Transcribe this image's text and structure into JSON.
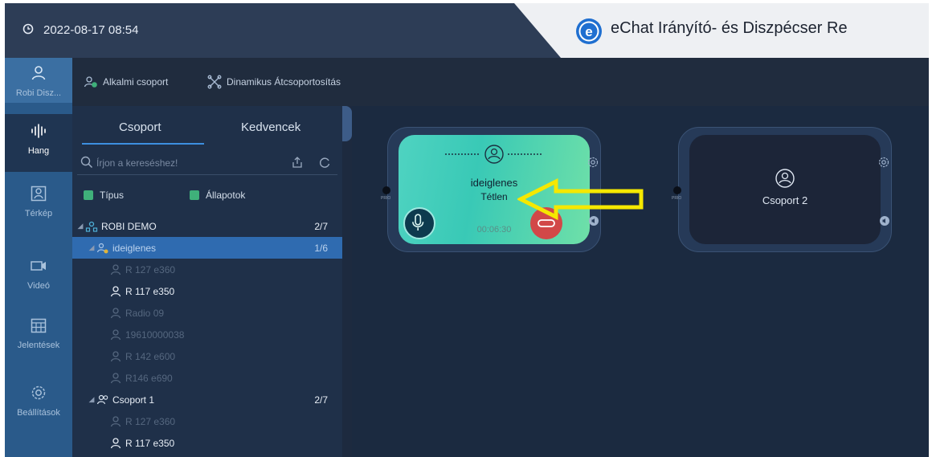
{
  "titlebar": {
    "datetime": "2022-08-17 08:54",
    "app_title": "eChat Irányító-  és Diszpécser Re",
    "logo_letter": "e"
  },
  "nav": [
    {
      "id": "robi",
      "label": "Robi Disz...",
      "icon": "person-icon"
    },
    {
      "id": "hang",
      "label": "Hang",
      "icon": "audio-wave-icon"
    },
    {
      "id": "terkep",
      "label": "Térkép",
      "icon": "map-person-icon"
    },
    {
      "id": "video",
      "label": "Videó",
      "icon": "video-camera-icon"
    },
    {
      "id": "jelentesek",
      "label": "Jelentések",
      "icon": "calendar-grid-icon"
    },
    {
      "id": "beallitasok",
      "label": "Beállítások",
      "icon": "gear-icon"
    }
  ],
  "toolbar": {
    "ad_hoc_group": "Alkalmi csoport",
    "dynamic_regroup": "Dinamikus Átcsoportosítás"
  },
  "panel": {
    "tab_groups": "Csoport",
    "tab_favorites": "Kedvencek",
    "search_placeholder": "Írjon a kereséshez!",
    "filter_type": "Típus",
    "filter_status": "Állapotok"
  },
  "tree": [
    {
      "label": "ROBI DEMO",
      "count": "2/7",
      "kind": "org"
    },
    {
      "label": "ideiglenes",
      "count": "1/6",
      "kind": "group-selected"
    },
    {
      "label": "R 127 e360",
      "kind": "member-offline"
    },
    {
      "label": "R 117 e350",
      "kind": "member-online"
    },
    {
      "label": "Radio 09",
      "kind": "member-offline"
    },
    {
      "label": "19610000038",
      "kind": "member-offline"
    },
    {
      "label": "R 142 e600",
      "kind": "member-offline"
    },
    {
      "label": "R146 e690",
      "kind": "member-offline"
    },
    {
      "label": "Csoport 1",
      "count": "2/7",
      "kind": "group"
    },
    {
      "label": "R 127 e360",
      "kind": "member-offline"
    },
    {
      "label": "R 117 e350",
      "kind": "member-online"
    }
  ],
  "cards": {
    "active": {
      "name": "ideiglenes",
      "state": "Tétlen",
      "timer": "00:06:30",
      "side_label": "PRIO"
    },
    "inactive": {
      "name": "Csoport 2",
      "side_label": "PRIO"
    }
  },
  "colors": {
    "accent": "#3d8fe0",
    "card_active": "#4fd3c1",
    "hangup": "#d24848",
    "annotation_arrow": "#f5e800"
  }
}
